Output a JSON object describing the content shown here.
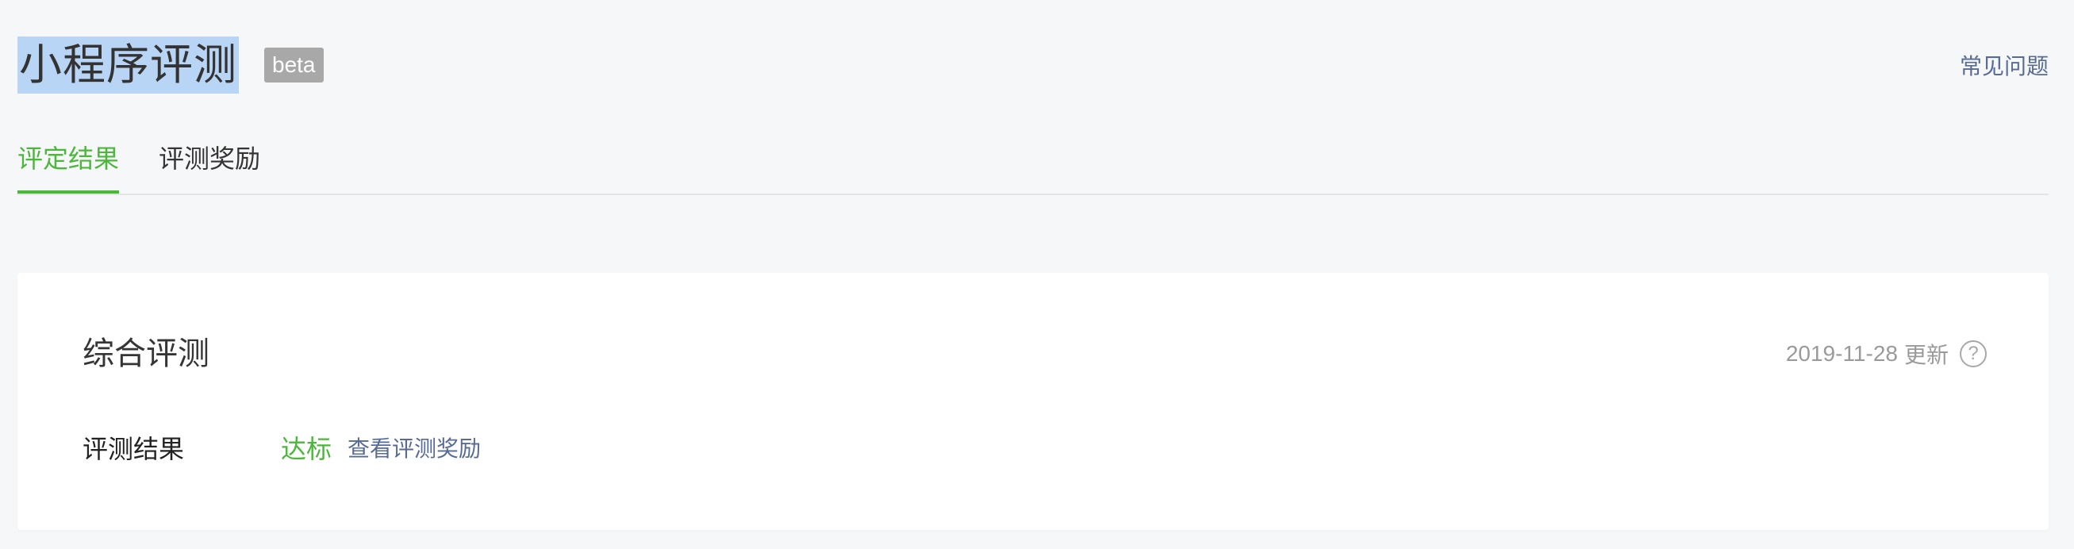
{
  "header": {
    "title": "小程序评测",
    "badge": "beta",
    "faq_link": "常见问题"
  },
  "tabs": [
    {
      "label": "评定结果",
      "active": true
    },
    {
      "label": "评测奖励",
      "active": false
    }
  ],
  "card": {
    "title": "综合评测",
    "update_date": "2019-11-28",
    "update_suffix": "更新",
    "help_icon": "?",
    "result": {
      "label": "评测结果",
      "value": "达标",
      "link": "查看评测奖励"
    }
  },
  "colors": {
    "accent": "#4db63c",
    "link": "#576b95",
    "background": "#f6f7f9",
    "title_highlight": "#b9d5f5",
    "badge_bg": "#a8a8a8"
  }
}
